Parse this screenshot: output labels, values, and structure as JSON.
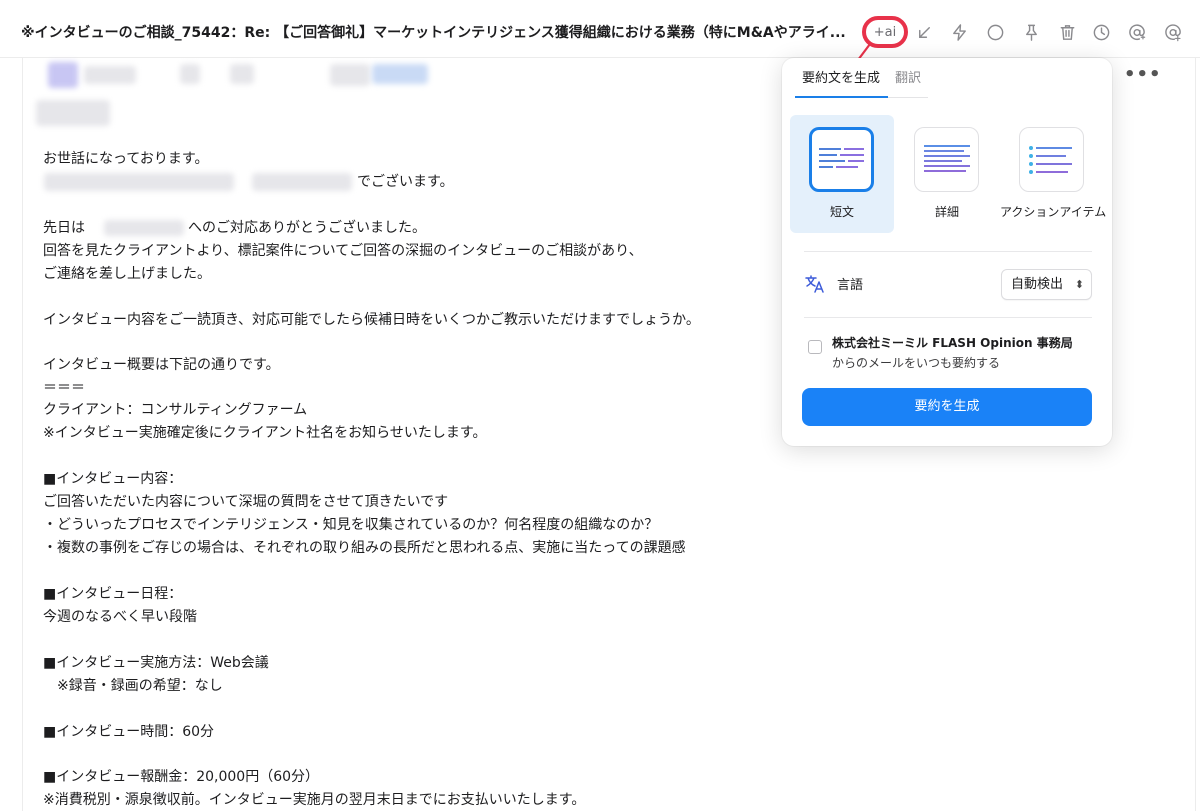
{
  "subject": "※インタビューのご相談_75442：Re: 【ご回答御礼】マーケットインテリジェンス獲得組織における業務（特にM&Aやアライ...",
  "toolbar": {
    "ai_label": "+ai",
    "icons": [
      "collapse-arrow-icon",
      "bolt-icon",
      "circle-icon",
      "pin-icon",
      "trash-icon",
      "clock-icon",
      "at-reply-icon",
      "at-add-icon"
    ]
  },
  "mail": {
    "more_label": "•••",
    "lines": [
      "お世話になっております。",
      "でございます。",
      "先日は",
      "へのご対応ありがとうございました。",
      "回答を見たクライアントより、標記案件についてご回答の深掘のインタビューのご相談があり、",
      "ご連絡を差し上げました。",
      "インタビュー内容をご一読頂き、対応可能でしたら候補日時をいくつかご教示いただけますでしょうか。",
      "インタビュー概要は下記の通りです。",
      "＝＝＝",
      "クライアント：コンサルティングファーム",
      "※インタビュー実施確定後にクライアント社名をお知らせいたします。",
      "■インタビュー内容：",
      "ご回答いただいた内容について深堀の質問をさせて頂きたいです",
      "・どういったプロセスでインテリジェンス・知見を収集されているのか？何名程度の組織なのか？",
      "・複数の事例をご存じの場合は、それぞれの取り組みの長所だと思われる点、実施に当たっての課題感",
      "■インタビュー日程：",
      "今週のなるべく早い段階",
      "■インタビュー実施方法：Web会議",
      "　※録音・録画の希望：なし",
      "■インタビュー時間：60分",
      "■インタビュー報酬金：20,000円（60分）",
      "※消費税別・源泉徴収前。インタビュー実施月の翌月末日までにお支払いいたします。"
    ]
  },
  "popover": {
    "tab_summary": "要約文を生成",
    "tab_translate": "翻訳",
    "styles": [
      {
        "label": "短文",
        "selected": true
      },
      {
        "label": "詳細",
        "selected": false
      },
      {
        "label": "アクションアイテム",
        "selected": false
      }
    ],
    "language_label": "言語",
    "language_value": "自動検出",
    "sender_name": "株式会社ミーミル FLASH Opinion 事務局",
    "sender_suffix": "からのメールをいつも要約する",
    "always_summarize_checked": false,
    "generate_label": "要約を生成"
  },
  "colors": {
    "accent": "#1a82f7",
    "highlight_ring": "#e8324a",
    "selected_bg": "#e4f0fb"
  }
}
